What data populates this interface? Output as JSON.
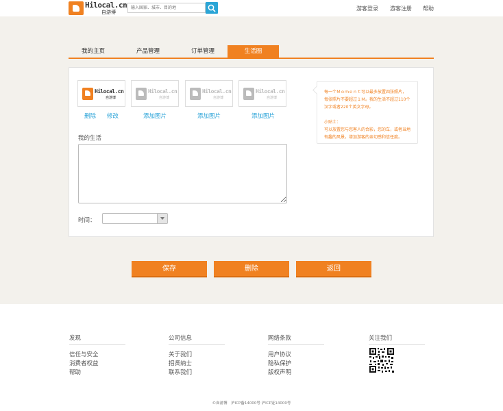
{
  "header": {
    "logo_text": "Hilocal.cn",
    "logo_cn": "自游博",
    "search_placeholder": "输入国家、城市、目的地",
    "nav": [
      "游客登录",
      "游客注册",
      "帮助"
    ]
  },
  "tabs": [
    {
      "label": "我的主页",
      "active": false
    },
    {
      "label": "产品管理",
      "active": false
    },
    {
      "label": "订单管理",
      "active": false
    },
    {
      "label": "生活圈",
      "active": true
    }
  ],
  "photos": {
    "first": {
      "delete": "删除",
      "edit": "修改"
    },
    "add_label": "添加图片"
  },
  "tip": {
    "lines": [
      "每一个Ｍｏｍｅｎｔ可以最多放置四张照片，",
      "每张照片不要超过１Ｍ。我的生活不超过110个",
      "汉字或者220个英文字母。",
      "",
      "小贴士：",
      "可以放置您与您客人的合影，您的车，或者当地",
      "有趣的风景。增加游客的亲切感和信任度。"
    ]
  },
  "form": {
    "life_label": "我的生活",
    "time_label": "时间："
  },
  "buttons": {
    "save": "保存",
    "delete": "删除",
    "back": "返回"
  },
  "footer": {
    "columns": [
      {
        "title": "发现",
        "links": [
          "信任与安全",
          "消费者权益",
          "帮助"
        ]
      },
      {
        "title": "公司信息",
        "links": [
          "关于我们",
          "招贤纳士",
          "联系我们"
        ]
      },
      {
        "title": "网络条款",
        "links": [
          "用户协议",
          "隐私保护",
          "版权声明"
        ]
      },
      {
        "title": "关注我们",
        "links": []
      }
    ],
    "copyright": "©自游博　沪ICP备14000号 沪ICP证14000号"
  },
  "colors": {
    "accent": "#f08121",
    "link": "#2aa3d8",
    "band": "#f3f1ec"
  }
}
